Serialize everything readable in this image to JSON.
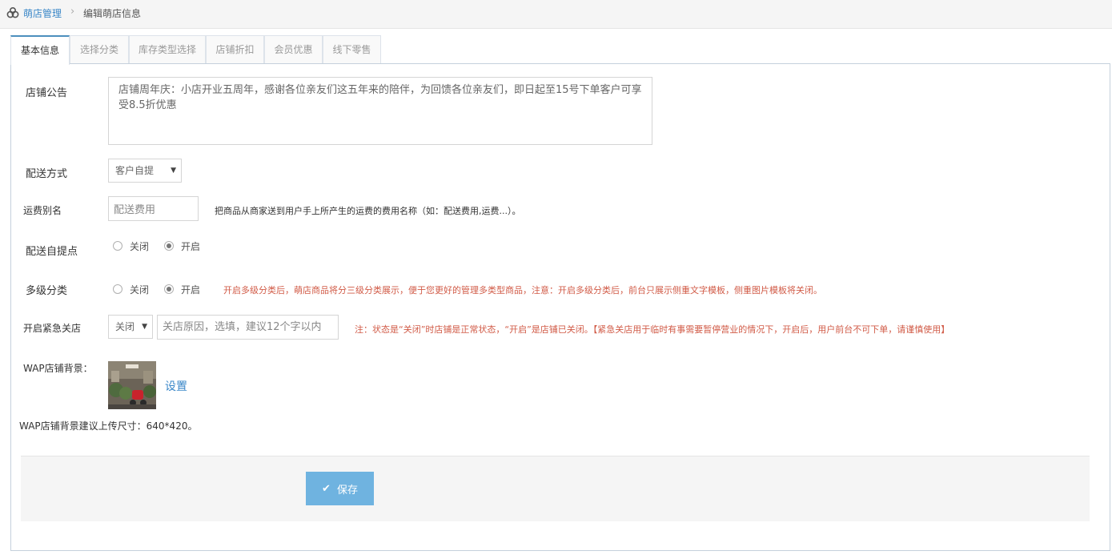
{
  "breadcrumb": {
    "parent": "萌店管理",
    "separator": "›",
    "current": "编辑萌店信息"
  },
  "tabs": [
    {
      "label": "基本信息",
      "active": true
    },
    {
      "label": "选择分类",
      "active": false
    },
    {
      "label": "库存类型选择",
      "active": false
    },
    {
      "label": "店铺折扣",
      "active": false
    },
    {
      "label": "会员优惠",
      "active": false
    },
    {
      "label": "线下零售",
      "active": false
    }
  ],
  "form": {
    "notice": {
      "label": "店铺公告",
      "value": "店铺周年庆：小店开业五周年，感谢各位亲友们这五年来的陪伴，为回馈各位亲友们，即日起至15号下单客户可享受8.5折优惠"
    },
    "delivery": {
      "label": "配送方式",
      "selected": "客户自提"
    },
    "fee_alias": {
      "label": "运费别名",
      "value": "配送费用",
      "help": "把商品从商家送到用户手上所产生的运费的费用名称（如：配送费用,运费...）。"
    },
    "pickup_point": {
      "label": "配送自提点",
      "off_label": "关闭",
      "on_label": "开启",
      "selected": "on"
    },
    "multi_category": {
      "label": "多级分类",
      "off_label": "关闭",
      "on_label": "开启",
      "selected": "on",
      "help": "开启多级分类后，萌店商品将分三级分类展示，便于您更好的管理多类型商品，注意：开启多级分类后，前台只展示侧重文字模板，侧重图片模板将关闭。"
    },
    "emergency_close": {
      "label": "开启紧急关店",
      "selected": "关闭",
      "reason_placeholder": "关店原因，选填，建议12个字以内",
      "help": "注：状态是“关闭”时店铺是正常状态，“开启”是店铺已关闭。【紧急关店用于临时有事需要暂停营业的情况下，开启后，用户前台不可下单，请谨慎使用】"
    },
    "wap_bg": {
      "label": "WAP店铺背景：",
      "set_label": "设置",
      "size_hint": "WAP店铺背景建议上传尺寸：640*420。"
    }
  },
  "actions": {
    "save_label": "保存"
  },
  "colors": {
    "link": "#3a87c8",
    "warning_text": "#d15b47",
    "save_button": "#6fb3e0",
    "active_tab_border": "#4c8fbd"
  }
}
